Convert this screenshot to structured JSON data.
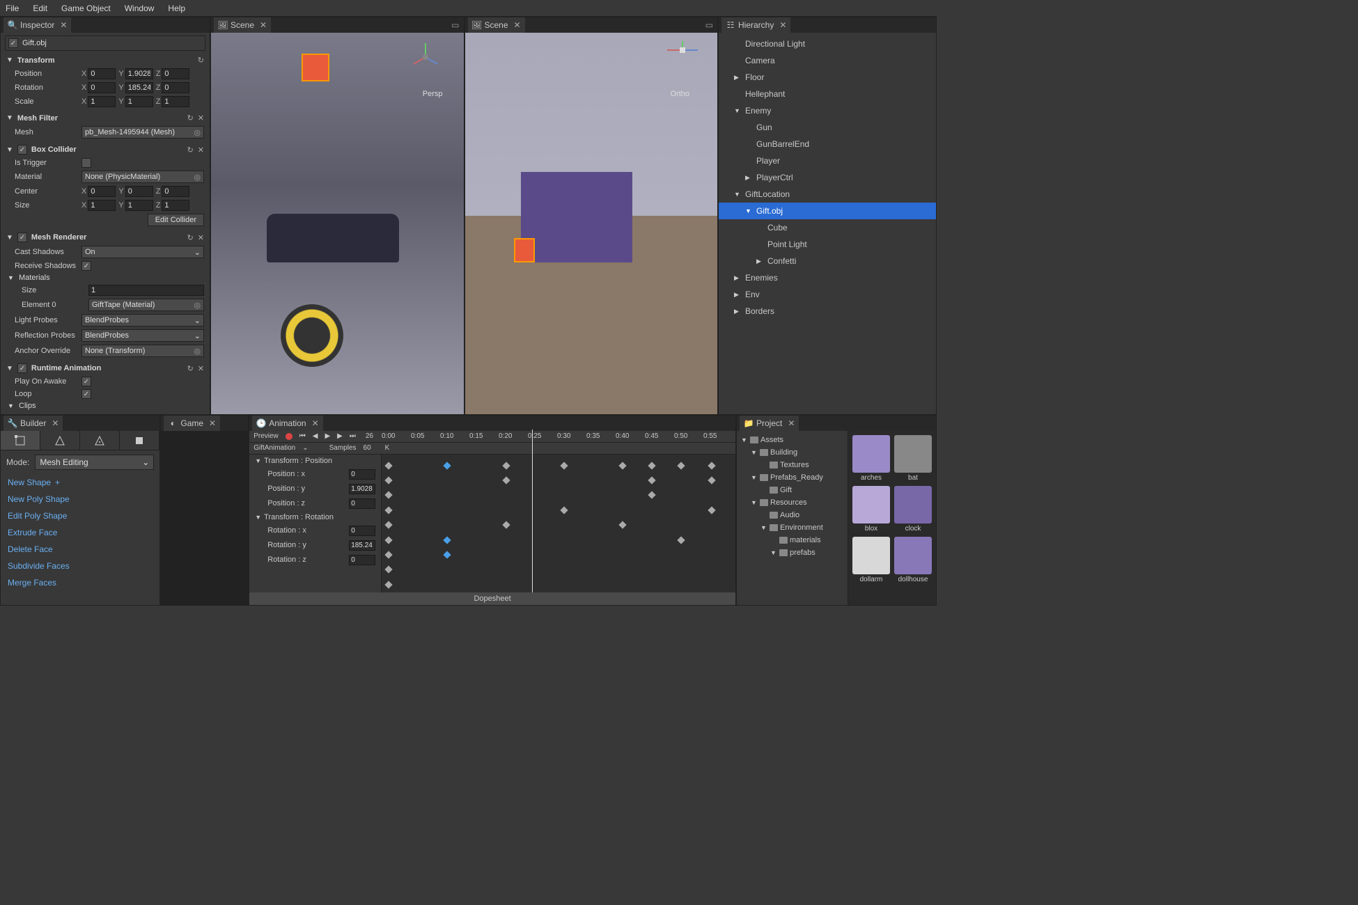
{
  "menu": {
    "file": "File",
    "edit": "Edit",
    "gameObject": "Game Object",
    "window": "Window",
    "help": "Help"
  },
  "inspector": {
    "tab": "Inspector",
    "objectName": "Gift.obj",
    "transform": {
      "title": "Transform",
      "position": {
        "label": "Position",
        "x": "0",
        "y": "1.90281",
        "z": "0"
      },
      "rotation": {
        "label": "Rotation",
        "x": "0",
        "y": "185.241",
        "z": "0"
      },
      "scale": {
        "label": "Scale",
        "x": "1",
        "y": "1",
        "z": "1"
      }
    },
    "meshFilter": {
      "title": "Mesh Filter",
      "meshLabel": "Mesh",
      "meshValue": "pb_Mesh-1495944 (Mesh)"
    },
    "boxCollider": {
      "title": "Box Collider",
      "isTrigger": "Is Trigger",
      "materialLabel": "Material",
      "materialValue": "None (PhysicMaterial)",
      "center": {
        "label": "Center",
        "x": "0",
        "y": "0",
        "z": "0"
      },
      "size": {
        "label": "Size",
        "x": "1",
        "y": "1",
        "z": "1"
      },
      "editCollider": "Edit Collider"
    },
    "meshRenderer": {
      "title": "Mesh Renderer",
      "castShadowsLabel": "Cast Shadows",
      "castShadowsValue": "On",
      "receiveShadowsLabel": "Receive Shadows",
      "materialsLabel": "Materials",
      "sizeLabel": "Size",
      "sizeValue": "1",
      "element0Label": "Element 0",
      "element0Value": "GiftTape (Material)",
      "lightProbesLabel": "Light Probes",
      "lightProbesValue": "BlendProbes",
      "reflProbesLabel": "Reflection Probes",
      "reflProbesValue": "BlendProbes",
      "anchorLabel": "Anchor Override",
      "anchorValue": "None (Transform)"
    },
    "runtimeAnimation": {
      "title": "Runtime Animation",
      "playOnAwake": "Play On Awake",
      "loop": "Loop",
      "clips": "Clips"
    }
  },
  "scene1": {
    "tab": "Scene",
    "mode": "Persp"
  },
  "scene2": {
    "tab": "Scene",
    "mode": "Ortho"
  },
  "hierarchy": {
    "tab": "Hierarchy",
    "items": [
      {
        "name": "Directional Light",
        "indent": 1,
        "arrow": ""
      },
      {
        "name": "Camera",
        "indent": 1,
        "arrow": ""
      },
      {
        "name": "Floor",
        "indent": 1,
        "arrow": "▶"
      },
      {
        "name": "Hellephant",
        "indent": 1,
        "arrow": ""
      },
      {
        "name": "Enemy",
        "indent": 1,
        "arrow": "▼"
      },
      {
        "name": "Gun",
        "indent": 2,
        "arrow": ""
      },
      {
        "name": "GunBarrelEnd",
        "indent": 2,
        "arrow": ""
      },
      {
        "name": "Player",
        "indent": 2,
        "arrow": ""
      },
      {
        "name": "PlayerCtrl",
        "indent": 2,
        "arrow": "▶"
      },
      {
        "name": "GiftLocation",
        "indent": 1,
        "arrow": "▼"
      },
      {
        "name": "Gift.obj",
        "indent": 2,
        "arrow": "▼",
        "selected": true
      },
      {
        "name": "Cube",
        "indent": 3,
        "arrow": ""
      },
      {
        "name": "Point Light",
        "indent": 3,
        "arrow": ""
      },
      {
        "name": "Confetti",
        "indent": 3,
        "arrow": "▶"
      },
      {
        "name": "Enemies",
        "indent": 1,
        "arrow": "▶"
      },
      {
        "name": "Env",
        "indent": 1,
        "arrow": "▶"
      },
      {
        "name": "Borders",
        "indent": 1,
        "arrow": "▶"
      }
    ]
  },
  "builder": {
    "tab": "Builder",
    "modeLabel": "Mode:",
    "modeValue": "Mesh Editing",
    "actions": [
      "New Shape",
      "New Poly Shape",
      "Edit Poly Shape",
      "Extrude Face",
      "Delete Face",
      "Subdivide Faces",
      "Merge Faces"
    ]
  },
  "game": {
    "tab": "Game"
  },
  "animation": {
    "tab": "Animation",
    "preview": "Preview",
    "frame": "26",
    "clip": "GiftAnimation",
    "samplesLabel": "Samples",
    "samplesValue": "60",
    "k": "K",
    "timecodes": [
      "0:00",
      "0:05",
      "0:10",
      "0:15",
      "0:20",
      "0:25",
      "0:30",
      "0:35",
      "0:40",
      "0:45",
      "0:50",
      "0:55"
    ],
    "tracks": {
      "transformPosition": "Transform : Position",
      "posx": "Position : x",
      "posxVal": "0",
      "posy": "Position : y",
      "posyVal": "1.9028",
      "posz": "Position : z",
      "poszVal": "0",
      "transformRotation": "Transform : Rotation",
      "rotx": "Rotation : x",
      "rotxVal": "0",
      "roty": "Rotation : y",
      "rotyVal": "185.24",
      "rotz": "Rotation : z",
      "rotzVal": "0"
    },
    "dopesheet": "Dopesheet"
  },
  "project": {
    "tab": "Project",
    "tree": [
      {
        "name": "Assets",
        "indent": 0,
        "arrow": "▼"
      },
      {
        "name": "Building",
        "indent": 1,
        "arrow": "▼"
      },
      {
        "name": "Textures",
        "indent": 2,
        "arrow": ""
      },
      {
        "name": "Prefabs_Ready",
        "indent": 1,
        "arrow": "▼"
      },
      {
        "name": "Gift",
        "indent": 2,
        "arrow": ""
      },
      {
        "name": "Resources",
        "indent": 1,
        "arrow": "▼"
      },
      {
        "name": "Audio",
        "indent": 2,
        "arrow": ""
      },
      {
        "name": "Environment",
        "indent": 2,
        "arrow": "▼"
      },
      {
        "name": "materials",
        "indent": 3,
        "arrow": ""
      },
      {
        "name": "prefabs",
        "indent": 3,
        "arrow": "▼"
      }
    ],
    "assets": [
      "arches",
      "bat",
      "blox",
      "clock",
      "dollarm",
      "dollhouse"
    ]
  }
}
